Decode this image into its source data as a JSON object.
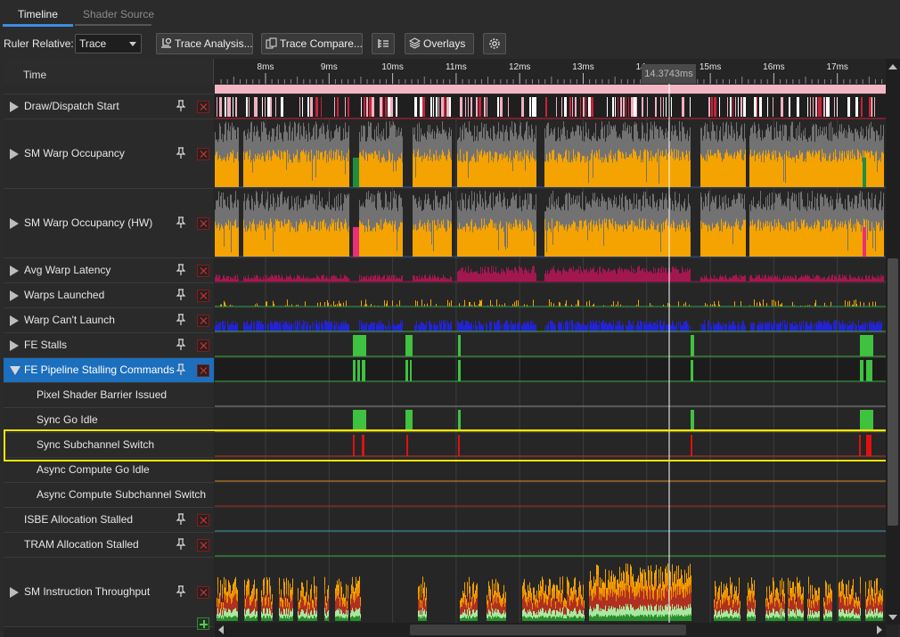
{
  "tabs": [
    {
      "label": "Timeline",
      "active": true
    },
    {
      "label": "Shader Source",
      "active": false
    }
  ],
  "toolbar": {
    "ruler_relative_label": "Ruler Relative:",
    "ruler_relative_value": "Trace",
    "trace_analysis": "Trace Analysis...",
    "trace_compare": "Trace Compare...",
    "overlays": "Overlays",
    "icons": [
      "trace-analysis-icon",
      "trace-compare-icon",
      "hierarchy-icon",
      "overlays-icon",
      "settings-icon"
    ]
  },
  "timeline": {
    "header": "Time",
    "ticks": [
      "8ms",
      "9ms",
      "10ms",
      "11ms",
      "12ms",
      "13ms",
      "14ms",
      "15ms",
      "16ms",
      "17ms"
    ],
    "cursor": "14.3743ms"
  },
  "rows": [
    {
      "label": "Draw/Dispatch Start",
      "expandable": true
    },
    {
      "label": "SM Warp Occupancy",
      "expandable": true
    },
    {
      "label": "SM Warp Occupancy (HW)",
      "expandable": true
    },
    {
      "label": "Avg Warp Latency",
      "expandable": true
    },
    {
      "label": "Warps Launched",
      "expandable": true
    },
    {
      "label": "Warp Can't Launch",
      "expandable": true
    },
    {
      "label": "FE Stalls",
      "expandable": true
    },
    {
      "label": "FE Pipeline Stalling Commands",
      "expandable": true,
      "expanded": true,
      "selected": true
    },
    {
      "label": "Pixel Shader Barrier Issued",
      "sub": true
    },
    {
      "label": "Sync Go Idle",
      "sub": true
    },
    {
      "label": "Sync Subchannel Switch",
      "sub": true,
      "highlighted": true
    },
    {
      "label": "Async Compute Go Idle",
      "sub": true
    },
    {
      "label": "Async Compute Subchannel Switch",
      "sub": true
    },
    {
      "label": "ISBE Allocation Stalled",
      "expandable": false
    },
    {
      "label": "TRAM Allocation Stalled",
      "expandable": false
    },
    {
      "label": "SM Instruction Throughput",
      "expandable": true
    }
  ],
  "colors": {
    "accent": "#3d8de0",
    "occupancy": "#f5a300",
    "occupancy_bg": "#6a6a6a",
    "latency": "#a3174f",
    "cant_launch": "#2323d0",
    "stall_green": "#3fc23f",
    "stall_red": "#e01010",
    "highlight": "#f3e600"
  }
}
